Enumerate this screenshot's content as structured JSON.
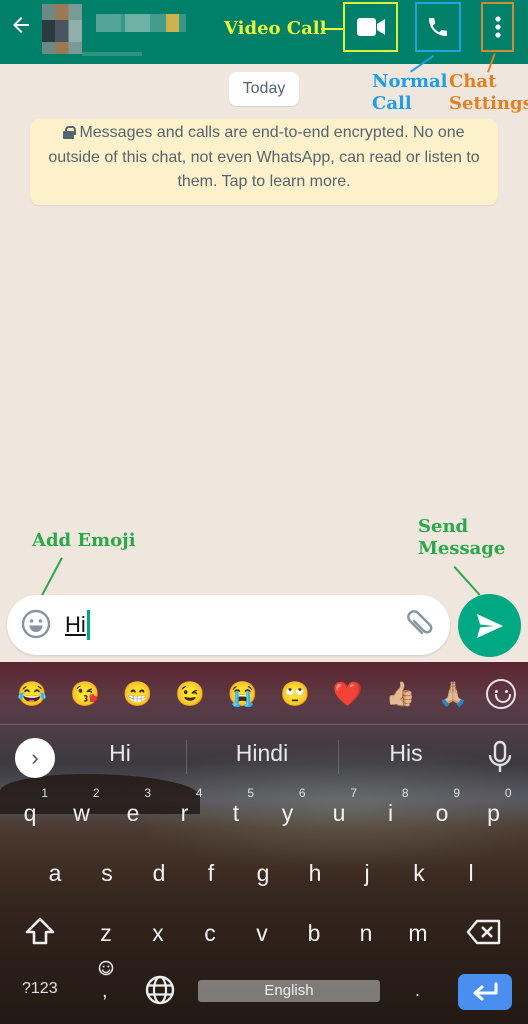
{
  "header": {
    "back_icon": "arrow-left-icon",
    "contact_name": "[blurred]",
    "video_call_icon": "video-camera-icon",
    "voice_call_icon": "phone-icon",
    "menu_icon": "more-vertical-icon",
    "color": "#008069"
  },
  "annotations": {
    "video_call": "Video Call",
    "normal_call": "Normal\nCall",
    "chat_settings": "Chat\nSettings",
    "add_emoji": "Add Emoji",
    "send_message": "Send\nMessage"
  },
  "chat": {
    "date_chip": "Today",
    "encryption_notice": "Messages and calls are end-to-end encrypted. No one outside of this chat, not even WhatsApp, can read or listen to them. Tap to learn more."
  },
  "composer": {
    "emoji_icon": "smiley-icon",
    "message_value": "Hi",
    "attach_icon": "paperclip-icon",
    "send_icon": "send-arrow-icon",
    "accent": "#00a884"
  },
  "keyboard": {
    "emoji_suggestions": [
      "😂",
      "😘",
      "😁",
      "😉",
      "😭",
      "🙄",
      "❤️",
      "👍🏼",
      "🙏🏼"
    ],
    "suggestions": [
      "Hi",
      "Hindi",
      "His"
    ],
    "row1": [
      "q",
      "w",
      "e",
      "r",
      "t",
      "y",
      "u",
      "i",
      "o",
      "p"
    ],
    "row1_hints": [
      "1",
      "2",
      "3",
      "4",
      "5",
      "6",
      "7",
      "8",
      "9",
      "0"
    ],
    "row2": [
      "a",
      "s",
      "d",
      "f",
      "g",
      "h",
      "j",
      "k",
      "l"
    ],
    "row3": [
      "z",
      "x",
      "c",
      "v",
      "b",
      "n",
      "m"
    ],
    "symbols_key": "?123",
    "comma_key": ",",
    "space_label": "English",
    "period_key": ".",
    "enter_color": "#4a8ff0"
  }
}
